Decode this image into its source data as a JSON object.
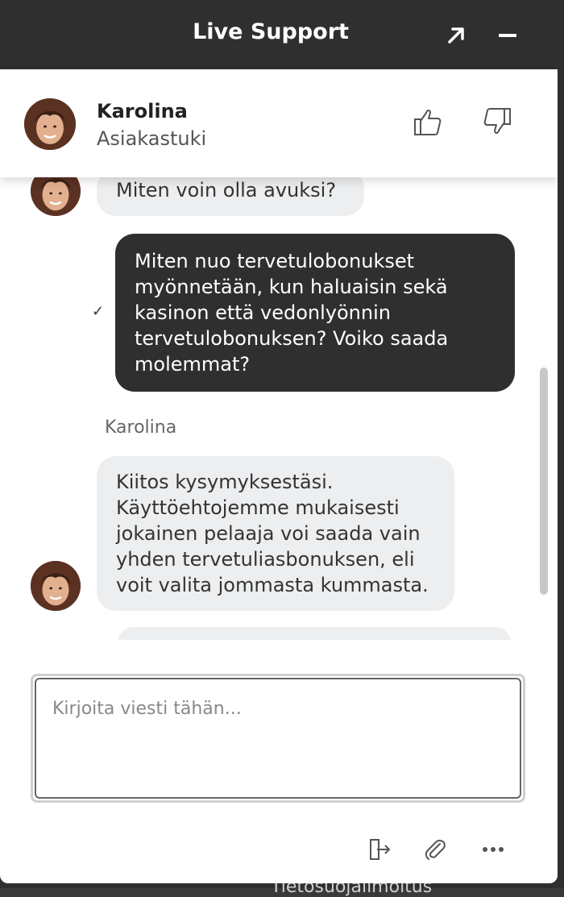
{
  "window": {
    "title": "Live Support",
    "expand_icon": "expand-arrow-icon",
    "minimize_icon": "minimize-icon"
  },
  "agent": {
    "name": "Karolina",
    "role": "Asiakastuki",
    "rate_up_icon": "thumbs-up-icon",
    "rate_down_icon": "thumbs-down-icon"
  },
  "messages": [
    {
      "from": "agent",
      "text": "Miten voin olla avuksi?"
    },
    {
      "from": "user",
      "lines": [
        "Miten nuo tervetulobonukset",
        "myönnetään, kun haluaisin sekä",
        "kasinon että vedonlyönnin",
        "tervetulobonuksen? Voiko saada",
        "molemmat?"
      ],
      "status": "✓"
    },
    {
      "from": "agent",
      "sender": "Karolina",
      "lines": [
        "Kiitos kysymyksestäsi.",
        "Käyttöehtojemme mukaisesti",
        "jokainen pelaaja voi saada vain",
        "yhden tervetuliasbonuksen, eli",
        "voit valita jommasta kummasta."
      ]
    }
  ],
  "composer": {
    "placeholder": "Kirjoita viesti tähän...",
    "value": ""
  },
  "footer": {
    "exit_icon": "exit-chat-icon",
    "attach_icon": "paperclip-icon",
    "more_icon": "more-dots-icon"
  },
  "backdrop": {
    "partial_text": "Tietosuojailmoitus"
  },
  "colors": {
    "titlebar": "#2f2f2f",
    "user_bubble": "#2f2f2f",
    "agent_bubble": "#eceef0"
  }
}
